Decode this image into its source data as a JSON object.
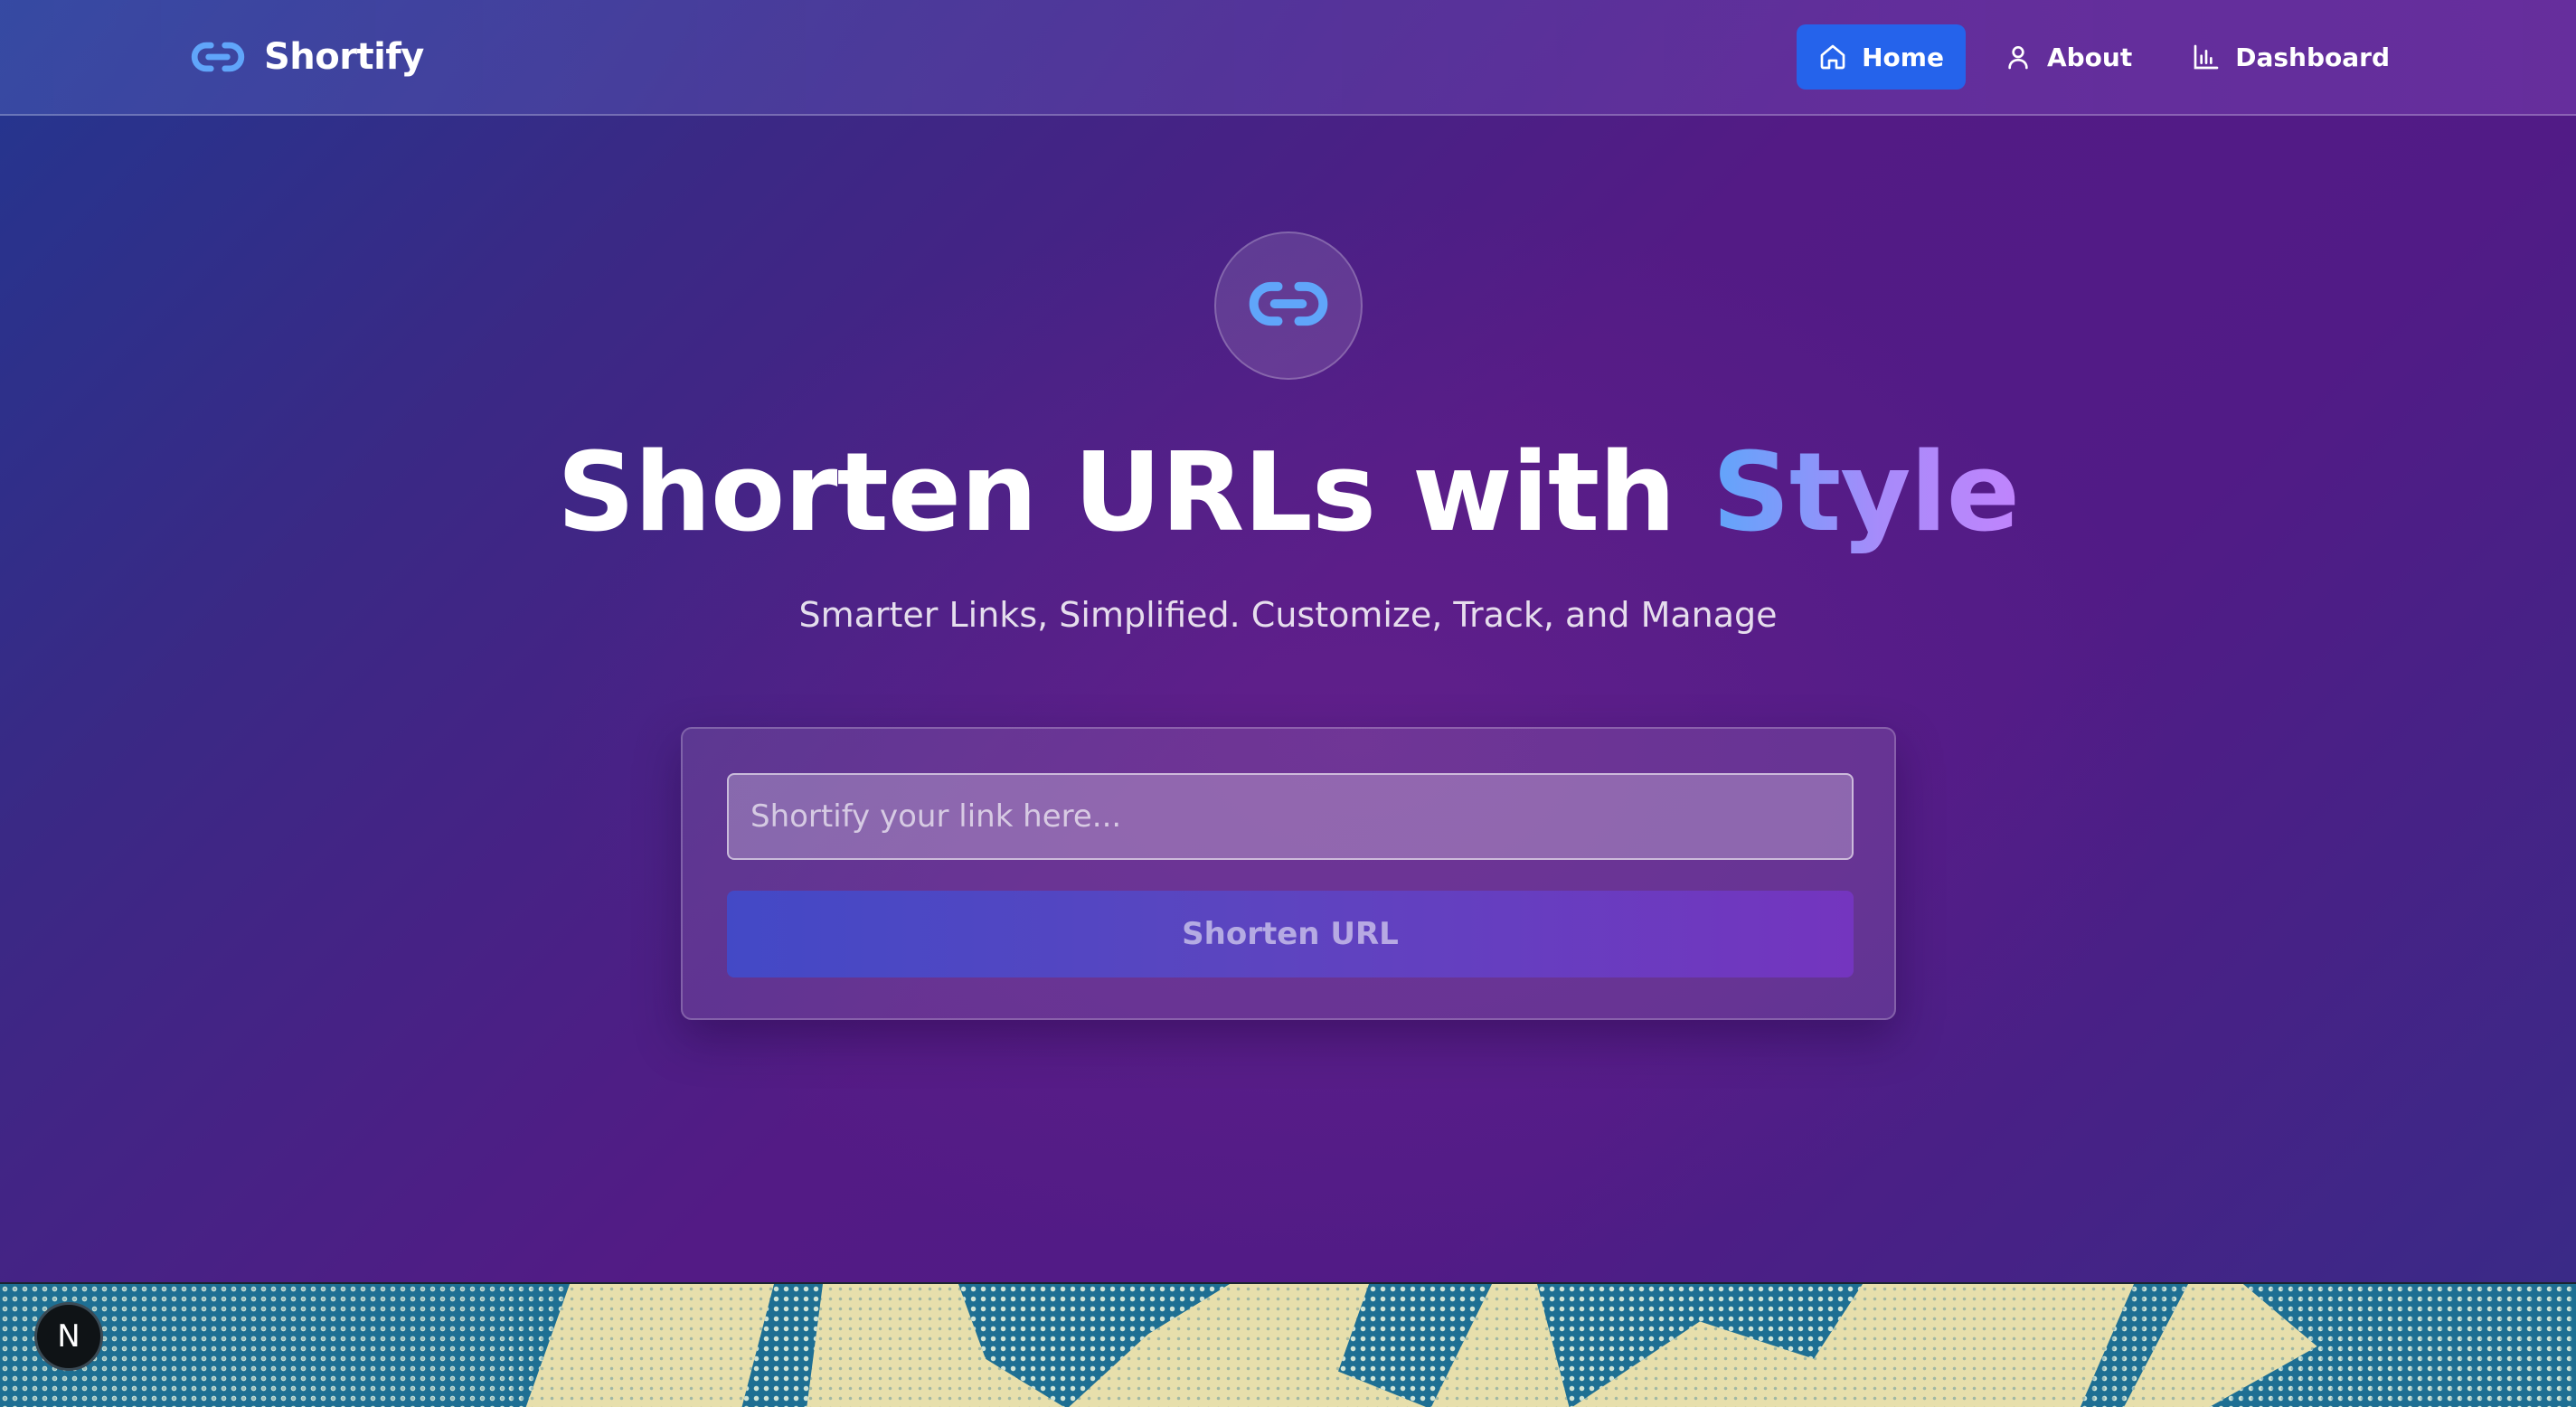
{
  "brand": {
    "name": "Shortify",
    "icon": "link-icon",
    "icon_color": "#60a5fa"
  },
  "nav": {
    "items": [
      {
        "label": "Home",
        "icon": "home-icon",
        "active": true
      },
      {
        "label": "About",
        "icon": "user-icon",
        "active": false
      },
      {
        "label": "Dashboard",
        "icon": "bar-chart-icon",
        "active": false
      }
    ],
    "active_color": "#2563eb"
  },
  "hero": {
    "icon": "link-icon",
    "title_main": "Shorten URLs with ",
    "title_accent": "Style",
    "subtitle": "Smarter Links, Simplified. Customize, Track, and Manage"
  },
  "form": {
    "input_placeholder": "Shortify your link here...",
    "input_value": "",
    "submit_label": "Shorten URL",
    "submit_enabled": false
  },
  "dev_badge": {
    "label": "N"
  }
}
